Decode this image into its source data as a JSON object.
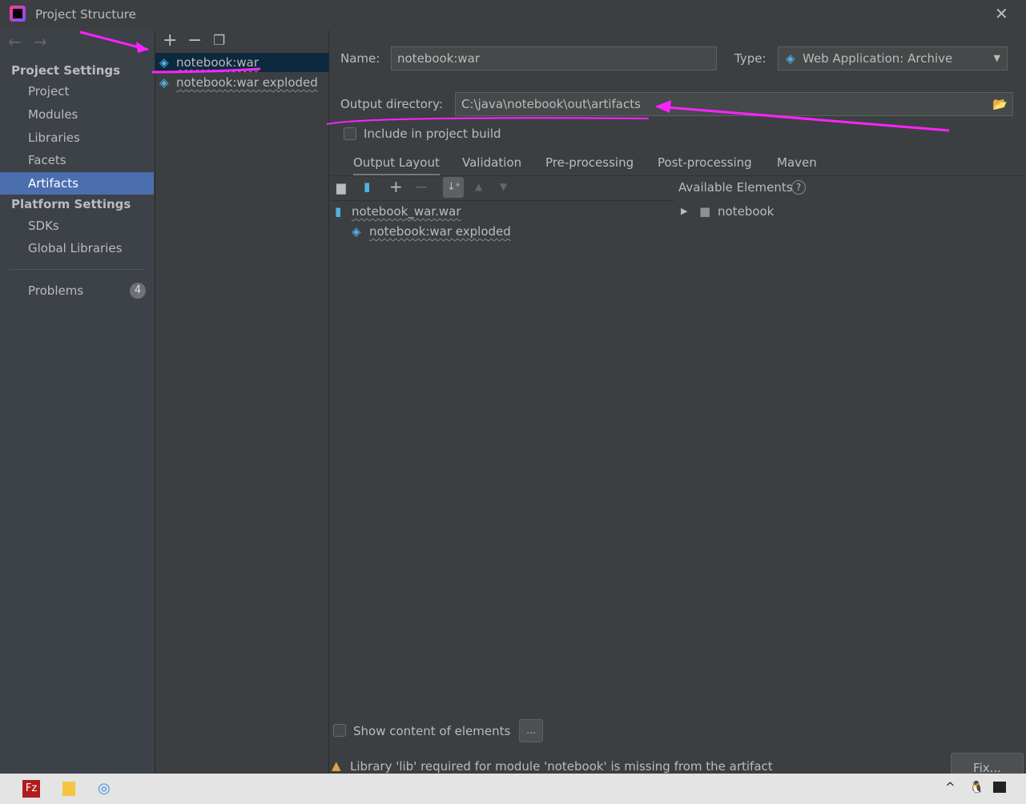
{
  "window": {
    "title": "Project Structure"
  },
  "sidebar": {
    "project_settings": "Project Settings",
    "items": [
      "Project",
      "Modules",
      "Libraries",
      "Facets",
      "Artifacts"
    ],
    "platform_settings": "Platform Settings",
    "platform_items": [
      "SDKs",
      "Global Libraries"
    ],
    "problems": "Problems",
    "problems_count": "4"
  },
  "artifacts": [
    "notebook:war",
    "notebook:war exploded"
  ],
  "form": {
    "name_label": "Name:",
    "name_value": "notebook:war",
    "type_label": "Type:",
    "type_value": "Web Application: Archive",
    "output_label": "Output directory:",
    "output_value": "C:\\java\\notebook\\out\\artifacts",
    "include_label": "Include in project build"
  },
  "tabs": [
    "Output Layout",
    "Validation",
    "Pre-processing",
    "Post-processing",
    "Maven"
  ],
  "layout": {
    "tree": [
      "notebook_war.war",
      "notebook:war exploded"
    ],
    "available_label": "Available Elements",
    "available": [
      "notebook"
    ]
  },
  "footer": {
    "show_content": "Show content of elements",
    "more": "...",
    "warning": "Library 'lib' required for module 'notebook' is missing from the artifact",
    "fix": "Fix..."
  },
  "colors": {
    "selection": "#4b6eaf",
    "annotation": "#ff22ff"
  }
}
